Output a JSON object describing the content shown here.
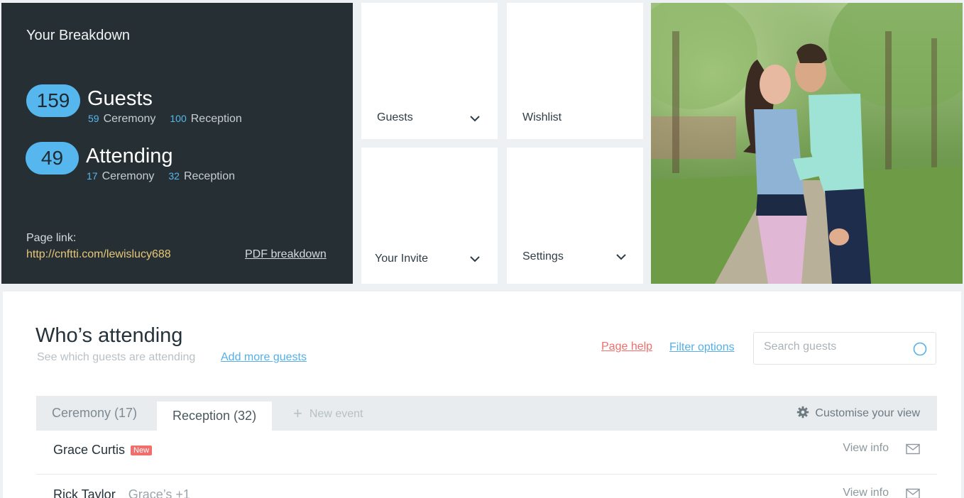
{
  "breakdown": {
    "title": "Your Breakdown",
    "guests": {
      "count": "159",
      "label": "Guests",
      "ceremony_count": "59",
      "ceremony_label": "Ceremony",
      "reception_count": "100",
      "reception_label": "Reception"
    },
    "attending": {
      "count": "49",
      "label": "Attending",
      "ceremony_count": "17",
      "ceremony_label": "Ceremony",
      "reception_count": "32",
      "reception_label": "Reception"
    },
    "page_link_label": "Page link:",
    "page_link": "http://cnftti.com/lewislucy688",
    "pdf_link": "PDF breakdown"
  },
  "tiles": {
    "guests": "Guests",
    "wishlist": "Wishlist",
    "invite": "Your Invite",
    "settings": "Settings"
  },
  "attending_section": {
    "title": "Who’s attending",
    "subtitle": "See which guests are attending",
    "add_link": "Add more guests",
    "help_link": "Page help",
    "filter_link": "Filter options",
    "search_placeholder": "Search guests"
  },
  "tabs": {
    "ceremony": "Ceremony (17)",
    "reception": "Reception (32)",
    "new_event": "New event",
    "customise": "Customise your view"
  },
  "rows": [
    {
      "name": "Grace Curtis",
      "badge": "New",
      "note": "",
      "view": "View info"
    },
    {
      "name": "Rick Taylor",
      "badge": "",
      "note": "Grace’s +1",
      "view": "View info"
    }
  ],
  "colors": {
    "accent": "#56b7ef",
    "dark_panel": "#263034",
    "link_red": "#ef6f6c",
    "link_gold": "#e7c677"
  },
  "icons": [
    "chevron-down-icon",
    "search-icon",
    "gear-icon",
    "plus-icon",
    "mail-icon"
  ]
}
